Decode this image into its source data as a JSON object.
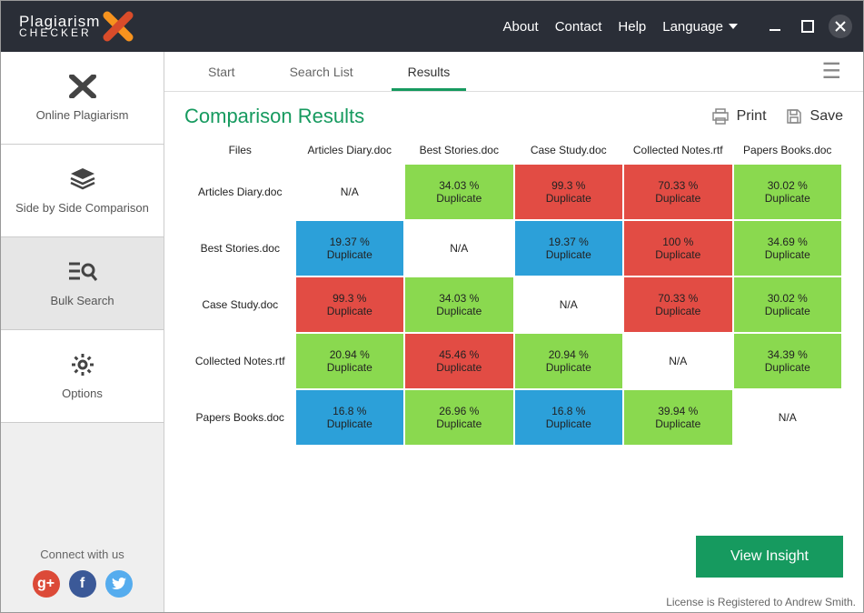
{
  "header": {
    "about": "About",
    "contact": "Contact",
    "help": "Help",
    "language": "Language"
  },
  "sidebar": {
    "items": [
      {
        "label": "Online Plagiarism"
      },
      {
        "label": "Side by Side Comparison"
      },
      {
        "label": "Bulk Search"
      },
      {
        "label": "Options"
      }
    ],
    "connect": "Connect with us"
  },
  "tabs": {
    "start": "Start",
    "search_list": "Search List",
    "results": "Results"
  },
  "title_row": {
    "title": "Comparison Results",
    "print": "Print",
    "save": "Save"
  },
  "files_header": "Files",
  "duplicate_label": "Duplicate",
  "na_label": "N/A",
  "columns": [
    "Articles Diary.doc",
    "Best Stories.doc",
    "Case Study.doc",
    "Collected Notes.rtf",
    "Papers Books.doc"
  ],
  "rows": [
    {
      "file": "Articles Diary.doc",
      "cells": [
        {
          "t": "na"
        },
        {
          "t": "green",
          "v": "34.03 %"
        },
        {
          "t": "red",
          "v": "99.3 %"
        },
        {
          "t": "red",
          "v": "70.33 %"
        },
        {
          "t": "green",
          "v": "30.02 %"
        }
      ]
    },
    {
      "file": "Best Stories.doc",
      "cells": [
        {
          "t": "blue",
          "v": "19.37 %"
        },
        {
          "t": "na"
        },
        {
          "t": "blue",
          "v": "19.37 %"
        },
        {
          "t": "red",
          "v": "100 %"
        },
        {
          "t": "green",
          "v": "34.69 %"
        }
      ]
    },
    {
      "file": "Case Study.doc",
      "cells": [
        {
          "t": "red",
          "v": "99.3 %"
        },
        {
          "t": "green",
          "v": "34.03 %"
        },
        {
          "t": "na"
        },
        {
          "t": "red",
          "v": "70.33 %"
        },
        {
          "t": "green",
          "v": "30.02 %"
        }
      ]
    },
    {
      "file": "Collected Notes.rtf",
      "cells": [
        {
          "t": "green",
          "v": "20.94 %"
        },
        {
          "t": "red",
          "v": "45.46 %"
        },
        {
          "t": "green",
          "v": "20.94 %"
        },
        {
          "t": "na"
        },
        {
          "t": "green",
          "v": "34.39 %"
        }
      ]
    },
    {
      "file": "Papers Books.doc",
      "cells": [
        {
          "t": "blue",
          "v": "16.8 %"
        },
        {
          "t": "green",
          "v": "26.96 %"
        },
        {
          "t": "blue",
          "v": "16.8 %"
        },
        {
          "t": "green",
          "v": "39.94 %"
        },
        {
          "t": "na"
        }
      ]
    }
  ],
  "view_insight": "View Insight",
  "license": "License is Registered to Andrew Smith."
}
